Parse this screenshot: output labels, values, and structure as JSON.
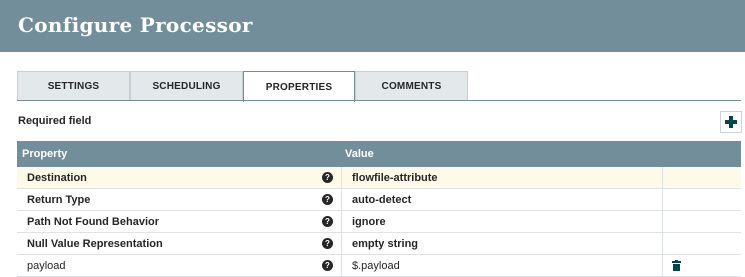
{
  "header": {
    "title": "Configure Processor"
  },
  "tabs": [
    {
      "label": "SETTINGS"
    },
    {
      "label": "SCHEDULING"
    },
    {
      "label": "PROPERTIES"
    },
    {
      "label": "COMMENTS"
    }
  ],
  "active_tab": "PROPERTIES",
  "required_label": "Required field",
  "table": {
    "headers": {
      "property": "Property",
      "value": "Value"
    },
    "rows": [
      {
        "name": "Destination",
        "value": "flowfile-attribute",
        "required": true,
        "highlighted": true
      },
      {
        "name": "Return Type",
        "value": "auto-detect",
        "required": true
      },
      {
        "name": "Path Not Found Behavior",
        "value": "ignore",
        "required": true
      },
      {
        "name": "Null Value Representation",
        "value": "empty string",
        "required": true
      },
      {
        "name": "payload",
        "value": "$.payload",
        "required": false,
        "deletable": true
      }
    ]
  },
  "icons": {
    "add": "plus-icon",
    "help": "question-circle-icon",
    "delete": "trash-icon"
  },
  "colors": {
    "header_bg": "#728e9b",
    "highlight_row": "#fdfae7",
    "icon_dark": "#004849"
  }
}
